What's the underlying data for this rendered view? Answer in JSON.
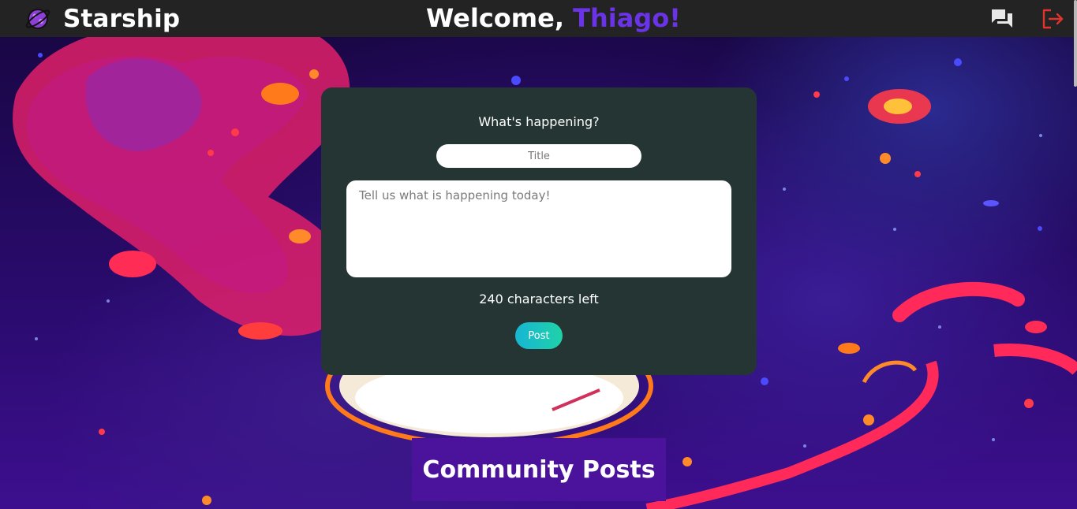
{
  "app": {
    "name": "Starship",
    "logo_icon": "planet-logo-icon"
  },
  "header": {
    "welcome_prefix": "Welcome, ",
    "username": "Thiago!",
    "icons": [
      "chat-bubbles-icon",
      "logout-icon"
    ]
  },
  "composer": {
    "prompt": "What's happening?",
    "title_placeholder": "Title",
    "title_value": "",
    "body_placeholder": "Tell us what is happening today!",
    "body_value": "",
    "chars_left": "240 characters left",
    "post_label": "Post"
  },
  "community": {
    "heading": "Community Posts"
  },
  "colors": {
    "header_bg": "#232323",
    "username": "#6b33e8",
    "card_bg": "#253533",
    "post_button_start": "#17b6d4",
    "post_button_end": "#1fd2a8",
    "community_bg": "#4b139c",
    "logout_icon": "#e0342c"
  }
}
